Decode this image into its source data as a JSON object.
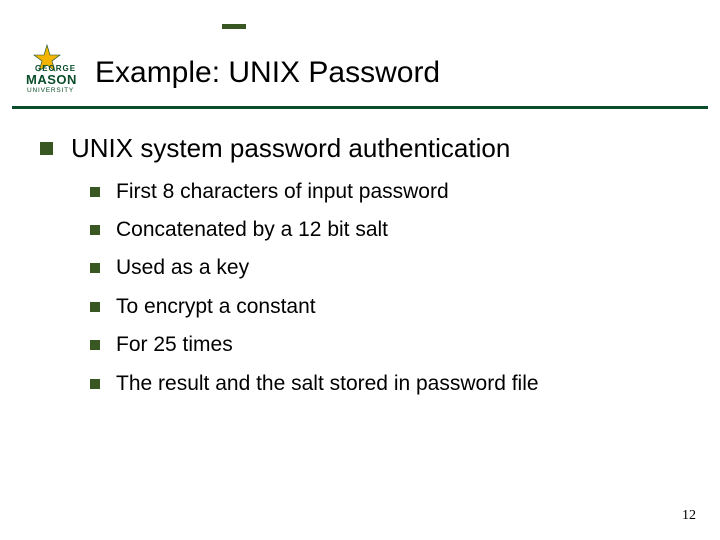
{
  "logo": {
    "george": "GEORGE",
    "mason": "MASON",
    "university": "UNIVERSITY"
  },
  "title": "Example: UNIX Password",
  "heading": "UNIX system password authentication",
  "items": [
    "First 8 characters of input password",
    "Concatenated by a 12 bit salt",
    "Used as a key",
    "To encrypt a constant",
    "For 25 times",
    "The result and the salt stored in password file"
  ],
  "page_number": "12"
}
